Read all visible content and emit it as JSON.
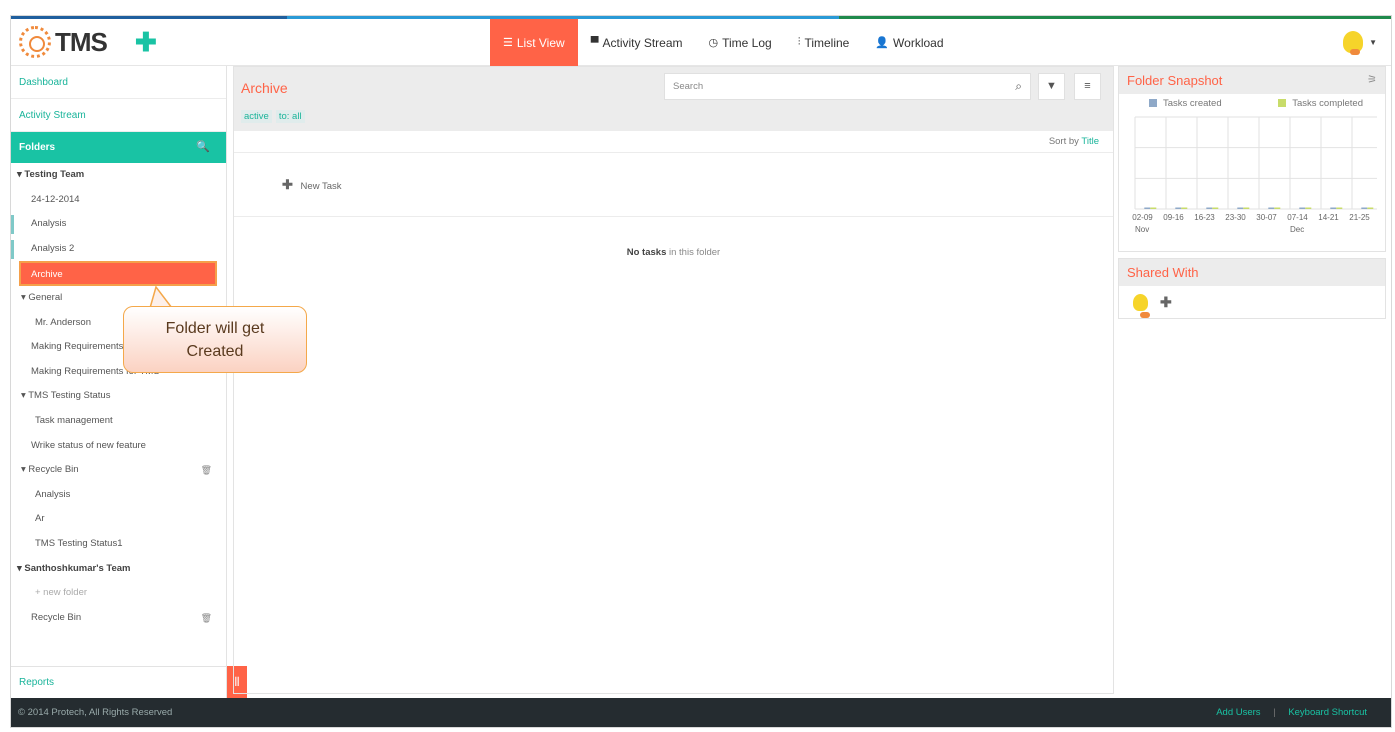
{
  "app": {
    "name": "TMS"
  },
  "nav": {
    "items": [
      {
        "label": "List View",
        "icon": "list-icon",
        "active": true
      },
      {
        "label": "Activity Stream",
        "icon": "comment-icon",
        "active": false
      },
      {
        "label": "Time Log",
        "icon": "clock-icon",
        "active": false
      },
      {
        "label": "Timeline",
        "icon": "sliders-icon",
        "active": false
      },
      {
        "label": "Workload",
        "icon": "user-icon",
        "active": false
      }
    ]
  },
  "sidebar": {
    "dashboard": "Dashboard",
    "activity_stream": "Activity Stream",
    "folders": "Folders",
    "reports": "Reports",
    "tree": [
      {
        "label": "Testing Team",
        "kind": "team"
      },
      {
        "label": "24-12-2014",
        "kind": "folder"
      },
      {
        "label": "Analysis",
        "kind": "folder"
      },
      {
        "label": "Analysis 2",
        "kind": "folder"
      },
      {
        "label": "Archive",
        "kind": "selected"
      },
      {
        "label": "General",
        "kind": "group"
      },
      {
        "label": "Mr. Anderson",
        "kind": "sub"
      },
      {
        "label": "Making Requirements",
        "kind": "folder"
      },
      {
        "label": "Making Requirements for TMS",
        "kind": "folder"
      },
      {
        "label": "TMS Testing Status",
        "kind": "group"
      },
      {
        "label": "Task management",
        "kind": "sub"
      },
      {
        "label": "Wrike status of new feature",
        "kind": "folder"
      },
      {
        "label": "Recycle Bin",
        "kind": "group"
      },
      {
        "label": "Analysis",
        "kind": "sub"
      },
      {
        "label": "Ar",
        "kind": "sub"
      },
      {
        "label": "TMS Testing Status1",
        "kind": "sub"
      },
      {
        "label": "Santhoshkumar's Team",
        "kind": "team"
      },
      {
        "label": "+ new folder",
        "kind": "newfolder"
      },
      {
        "label": "Recycle Bin",
        "kind": "folder"
      }
    ]
  },
  "main": {
    "title": "Archive",
    "filter_status": "active",
    "filter_to": "to: all",
    "search_placeholder": "Search",
    "sort_prefix": "Sort by",
    "sort_value": "Title",
    "new_task": "New Task",
    "empty_bold": "No tasks",
    "empty_rest": " in this folder"
  },
  "snapshot": {
    "title": "Folder Snapshot",
    "legend_created": "Tasks created",
    "legend_completed": "Tasks completed",
    "color_created": "#8fa9c8",
    "color_completed": "#c8dc6a"
  },
  "chart_data": {
    "type": "bar",
    "categories": [
      "02-09",
      "09-16",
      "16-23",
      "23-30",
      "30-07",
      "07-14",
      "14-21",
      "21-25"
    ],
    "series": [
      {
        "name": "Tasks created",
        "values": [
          0,
          0,
          0,
          0,
          0,
          0,
          0,
          0
        ]
      },
      {
        "name": "Tasks completed",
        "values": [
          0,
          0,
          0,
          0,
          0,
          0,
          0,
          0
        ]
      }
    ],
    "month_labels": [
      "Nov",
      "Dec"
    ],
    "grid": true
  },
  "shared": {
    "title": "Shared With"
  },
  "footer": {
    "copyright": "© 2014 Protech, All Rights Reserved",
    "add_users": "Add Users",
    "separator": "|",
    "keyboard": "Keyboard Shortcut"
  },
  "callout": {
    "line1": "Folder will get",
    "line2": "Created"
  }
}
